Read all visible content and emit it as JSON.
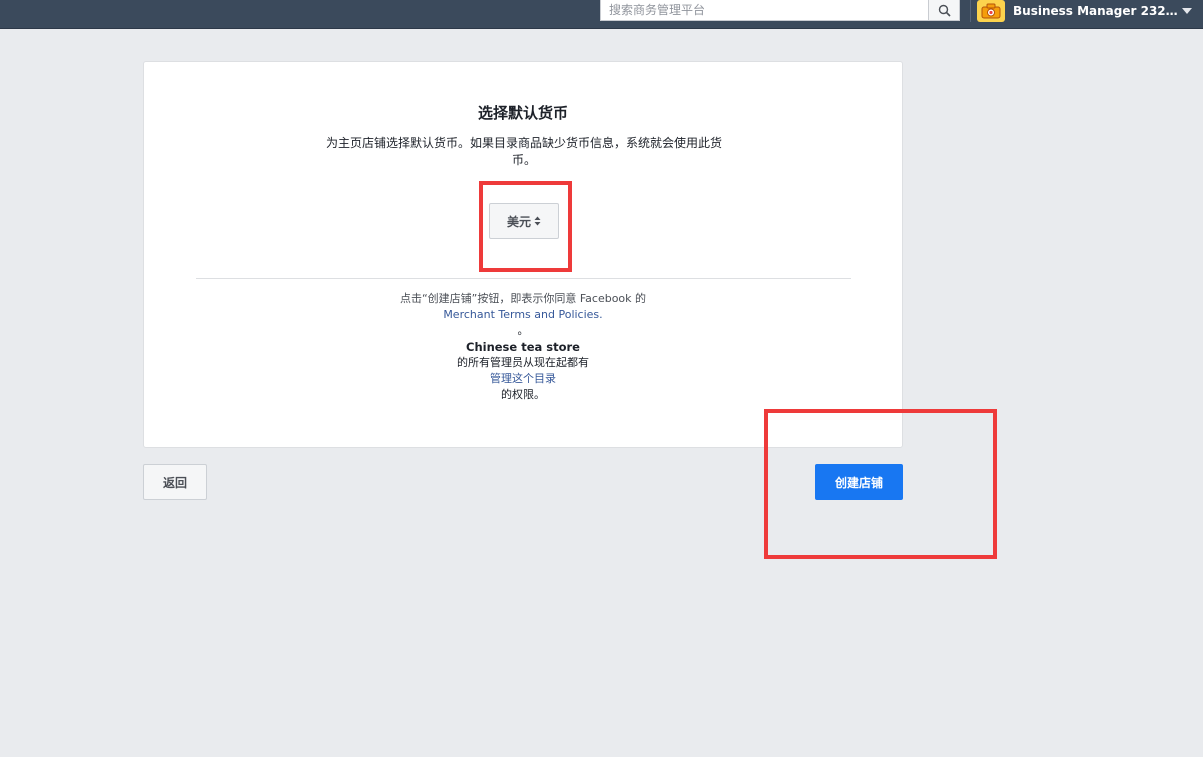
{
  "topbar": {
    "search_placeholder": "搜索商务管理平台",
    "account_name": "Business Manager 23223..."
  },
  "dialog": {
    "title": "选择默认货币",
    "description": "为主页店铺选择默认货币。如果目录商品缺少货币信息，系统就会使用此货币。",
    "currency": {
      "selected": "美元"
    },
    "legal": {
      "line1": "点击“创建店铺”按钮，即表示你同意 Facebook 的",
      "terms_link": "Merchant Terms and Policies.",
      "period": "。",
      "store_name": "Chinese tea store",
      "line4": "的所有管理员从现在起都有",
      "manage_link": "管理这个目录",
      "line6": "的权限。"
    }
  },
  "actions": {
    "back_label": "返回",
    "create_label": "创建店铺"
  },
  "colors": {
    "topbar": "#3b4a5c",
    "primary_button": "#1877f2",
    "link": "#365899",
    "annotation": "#ee3a3a",
    "page_background": "#e9ebee"
  }
}
